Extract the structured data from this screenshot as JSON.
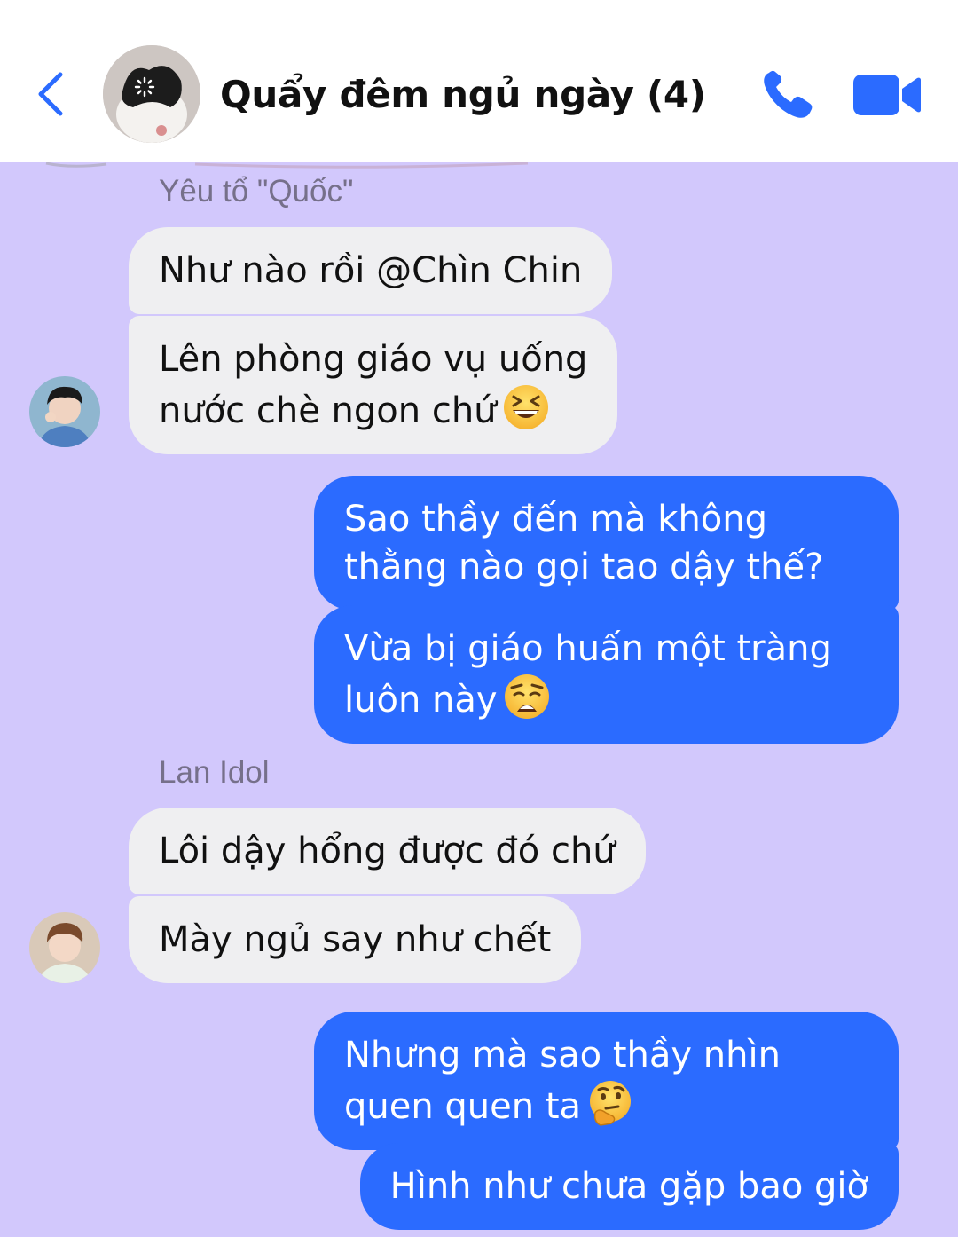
{
  "header": {
    "title": "Quẩy đêm ngủ ngày (4)",
    "back_icon": "chevron-left-icon",
    "call_icon": "phone-icon",
    "video_icon": "video-camera-icon",
    "accent_color": "#2b6bff"
  },
  "thread": {
    "background_color": "#d2c8fc",
    "messages": [
      {
        "sender": "Yêu tổ \"Quốc\"",
        "direction": "incoming",
        "text": "Như nào rồi @Chìn Chin"
      },
      {
        "direction": "incoming",
        "text_lines": [
          "Lên phòng giáo vụ uống",
          "nước chè ngon chứ"
        ],
        "emoji": "grinning-squinting-face-icon"
      },
      {
        "direction": "outgoing",
        "text_lines": [
          "Sao thầy đến mà không",
          "thằng nào gọi tao dậy thế?"
        ]
      },
      {
        "direction": "outgoing",
        "text_lines": [
          "Vừa bị giáo huấn một tràng",
          "luôn này"
        ],
        "emoji": "weary-face-icon"
      },
      {
        "sender": "Lan Idol",
        "direction": "incoming",
        "text": "Lôi dậy hổng được đó chứ"
      },
      {
        "direction": "incoming",
        "text": "Mày ngủ say như chết"
      },
      {
        "direction": "outgoing",
        "text_lines": [
          "Nhưng mà sao thầy nhìn",
          "quen quen ta"
        ],
        "emoji": "thinking-face-icon"
      },
      {
        "direction": "outgoing",
        "text": "Hình như chưa gặp bao giờ"
      }
    ]
  }
}
